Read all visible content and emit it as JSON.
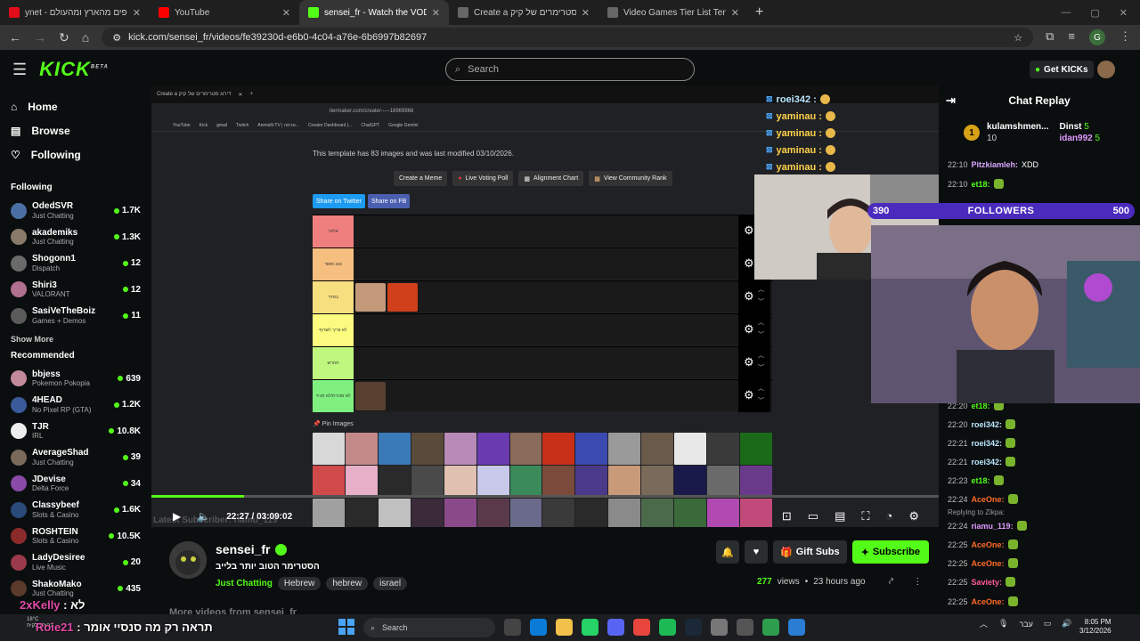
{
  "browser": {
    "tabs": [
      {
        "title": "ynet - חדשות, כלכלה, ספורט ובריאות - דיווחים שוטפים מהארץ ומהעולם",
        "color": "#e30c1b",
        "active": false
      },
      {
        "title": "YouTube",
        "color": "#ff0000",
        "active": false
      },
      {
        "title": "sensei_fr - Watch the VOD on Kick",
        "color": "#53fc18",
        "active": true
      },
      {
        "title": "Create a דירוג סטרימרים של קיק Tier List",
        "color": "#444",
        "active": false
      },
      {
        "title": "Video Games Tier List Template",
        "color": "#444",
        "active": false
      }
    ],
    "url": "kick.com/sensei_fr/videos/fe39230d-e6b0-4c04-a76e-6b6997b82697",
    "profile_letter": "G"
  },
  "topbar": {
    "logo": "KICK",
    "logo_sup": "BETA",
    "search_placeholder": "Search",
    "get_kicks": "Get KICKs"
  },
  "sidebar": {
    "nav": [
      {
        "label": "Home",
        "icon": "home-icon",
        "glyph": "⌂"
      },
      {
        "label": "Browse",
        "icon": "browse-icon",
        "glyph": "▤"
      },
      {
        "label": "Following",
        "icon": "heart-icon",
        "glyph": "♡"
      }
    ],
    "following_title": "Following",
    "following": [
      {
        "name": "OdedSVR",
        "category": "Just Chatting",
        "viewers": "1.7K",
        "color": "#4a6fa5"
      },
      {
        "name": "akademiks",
        "category": "Just Chatting",
        "viewers": "1.3K",
        "color": "#8a7a6a"
      },
      {
        "name": "Shogonn1",
        "category": "Dispatch",
        "viewers": "12",
        "color": "#6a6a6a"
      },
      {
        "name": "Shiri3",
        "category": "VALORANT",
        "viewers": "12",
        "color": "#b07090"
      },
      {
        "name": "SasiVeTheBoiz",
        "category": "Games + Demos",
        "viewers": "11",
        "color": "#5a5a5a"
      }
    ],
    "show_more": "Show More",
    "recommended_title": "Recommended",
    "recommended": [
      {
        "name": "bbjess",
        "category": "Pokemon Pokopia",
        "viewers": "639",
        "color": "#c08a9a"
      },
      {
        "name": "4HEAD",
        "category": "No Pixel RP (GTA)",
        "viewers": "1.2K",
        "color": "#3a5a9a"
      },
      {
        "name": "TJR",
        "category": "IRL",
        "viewers": "10.8K",
        "color": "#eee"
      },
      {
        "name": "AverageShad",
        "category": "Just Chatting",
        "viewers": "39",
        "color": "#7a6a5a"
      },
      {
        "name": "JDevise",
        "category": "Delta Force",
        "viewers": "34",
        "color": "#8a4aa8"
      },
      {
        "name": "Classybeef",
        "category": "Slots & Casino",
        "viewers": "1.6K",
        "color": "#2a4a7a"
      },
      {
        "name": "ROSHTEIN",
        "category": "Slots & Casino",
        "viewers": "10.5K",
        "color": "#8a2a2a"
      },
      {
        "name": "LadyDesiree",
        "category": "Live Music",
        "viewers": "20",
        "color": "#9a3a4a"
      },
      {
        "name": "ShakoMako",
        "category": "Just Chatting",
        "viewers": "435",
        "color": "#5a3a2a"
      }
    ]
  },
  "video": {
    "inner_tabs": [
      "Create a דירוג סטרימרים של קיק",
      "+"
    ],
    "inner_url": "tiermaker.com/create/-----18969968",
    "inner_bookmarks": [
      "YouTube",
      "Kick",
      "gmail",
      "Twitch",
      "Animelli-TV | אנימה...",
      "Creator Dashboard |...",
      "ChatGPT",
      "Google Gemini"
    ],
    "template_note": "This template has 83 images and was last modified 03/10/2026.",
    "buttons": [
      "Create a Meme",
      "Live Voting Poll",
      "Alignment Chart",
      "View Community Rank"
    ],
    "share_twitter": "Share on Twitter",
    "share_fb": "Share on FB",
    "tiers": [
      {
        "label": "אלוהי",
        "color": "#ef7f7f"
      },
      {
        "label": "טוב מאוד",
        "color": "#f7bf7f"
      },
      {
        "label": "בסדר",
        "color": "#f7de7f"
      },
      {
        "label": "לא צריך לשרוף",
        "color": "#fbfb7f"
      },
      {
        "label": "תחרש",
        "color": "#bff77f"
      },
      {
        "label": "לא מוכרת/לא מכיר",
        "color": "#7fef7f"
      }
    ],
    "pin_label": "Pin Images",
    "chat_overlay": [
      {
        "user": "roei342 :",
        "color": "#b9e7ff"
      },
      {
        "user": "yaminau :",
        "color": "#ffd24a"
      },
      {
        "user": "yaminau :",
        "color": "#ffd24a"
      },
      {
        "user": "yaminau :",
        "color": "#ffd24a"
      },
      {
        "user": "yaminau :",
        "color": "#ffd24a"
      }
    ],
    "followers_current": "390",
    "followers_label": "FOLLOWERS",
    "followers_goal": "500",
    "latest_sub": "Latest Subscriber: riamu_119",
    "time": "22:27 / 03:09:02",
    "progress": 0.118
  },
  "chat": {
    "title": "Chat Replay",
    "leaderboard": [
      {
        "name": "kulamshmen...",
        "score": "10"
      },
      {
        "name": "Dinst",
        "score": "5"
      },
      {
        "name": "idan992",
        "score": "5"
      }
    ],
    "leader_rank": "1",
    "messages": [
      {
        "time": "22:10",
        "user": "Pitzkiamleh:",
        "text": "XDD",
        "color": "#d9a6ff"
      },
      {
        "time": "22:10",
        "user": "et18:",
        "text": "",
        "color": "#53fc18"
      },
      {
        "time": "22:20",
        "user": "et18:",
        "text": "",
        "color": "#53fc18"
      },
      {
        "time": "22:20",
        "user": "roei342:",
        "text": "",
        "color": "#b9e7ff"
      },
      {
        "time": "22:21",
        "user": "roei342:",
        "text": "",
        "color": "#b9e7ff"
      },
      {
        "time": "22:21",
        "user": "roei342:",
        "text": "",
        "color": "#b9e7ff"
      },
      {
        "time": "22:23",
        "user": "et18:",
        "text": "",
        "color": "#53fc18"
      },
      {
        "time": "22:24",
        "user": "AceOne:",
        "text": "",
        "color": "#ff6a2a"
      },
      {
        "time": "22:24",
        "user": "riamu_119:",
        "text": "",
        "color": "#e099ff"
      },
      {
        "time": "22:25",
        "user": "AceOne:",
        "text": "",
        "color": "#ff6a2a"
      },
      {
        "time": "22:25",
        "user": "AceOne:",
        "text": "",
        "color": "#ff6a2a"
      },
      {
        "time": "22:25",
        "user": "Saviety:",
        "text": "",
        "color": "#ff5a9a"
      },
      {
        "time": "22:25",
        "user": "AceOne:",
        "text": "",
        "color": "#ff6a2a"
      }
    ],
    "reply_to": "Replying to Zikpa:"
  },
  "channel": {
    "name": "sensei_fr",
    "title": "הסטרימר הטוב יותר בלייב",
    "category": "Just Chatting",
    "tags": [
      "Hebrew",
      "hebrew",
      "israel"
    ],
    "gift_subs": "Gift Subs",
    "subscribe": "Subscribe",
    "views_count": "277",
    "views_label": "views",
    "ago": "23 hours ago",
    "more_videos": "More videos from sensei_fr"
  },
  "overlay": {
    "line1_user": "2xKelly",
    "line1_text": ": לא",
    "line2_user": "Roie21",
    "line2_text": ": תראה רק מה סנסיי אומר"
  },
  "taskbar": {
    "weather_temp": "18°C",
    "weather_desc": "בהיר חלקית",
    "search": "Search",
    "lang": "עבר",
    "time": "8:05 PM",
    "date": "3/12/2026"
  }
}
